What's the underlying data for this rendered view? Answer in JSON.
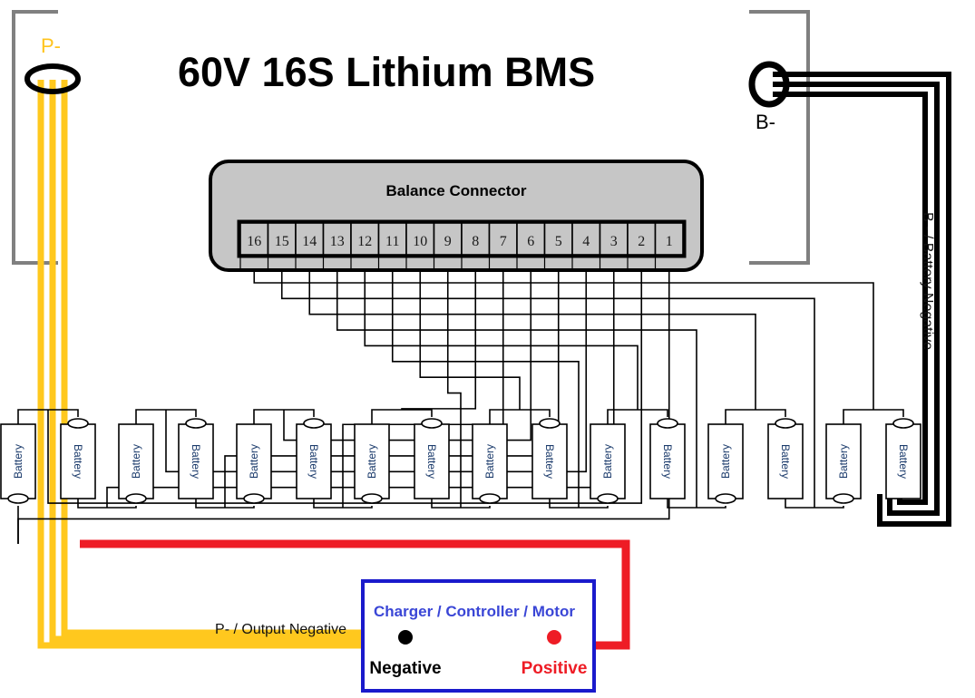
{
  "title": "60V 16S Lithium BMS",
  "colors": {
    "yellow": "#FFC81E",
    "red": "#EE1C25",
    "blue": "#1A1ACC",
    "ccm_text": "#3A46D6",
    "gray_frame": "#808080",
    "connector_fill": "#C6C6C6",
    "pin_fill": "#C6C6C6",
    "black": "#000000"
  },
  "terminals": {
    "p_minus": {
      "label": "P-",
      "wire_count": 3,
      "wire_color": "#FFC81E"
    },
    "b_minus": {
      "label": "B-",
      "wire_count": 3,
      "wire_color": "#000000"
    }
  },
  "connector": {
    "title": "Balance Connector",
    "pins": [
      "16",
      "15",
      "14",
      "13",
      "12",
      "11",
      "10",
      "9",
      "8",
      "7",
      "6",
      "5",
      "4",
      "3",
      "2",
      "1"
    ]
  },
  "batteries": {
    "label": "Battery",
    "count": 16,
    "pairs": 8
  },
  "labels": {
    "battery_negative": "B - / Battery Negative",
    "output_negative": "P- / Output Negative"
  },
  "load_box": {
    "title": "Charger / Controller / Motor",
    "negative_terminal": "Negative",
    "positive_terminal": "Positive",
    "negative_color": "#000000",
    "positive_color": "#EE1C25"
  }
}
